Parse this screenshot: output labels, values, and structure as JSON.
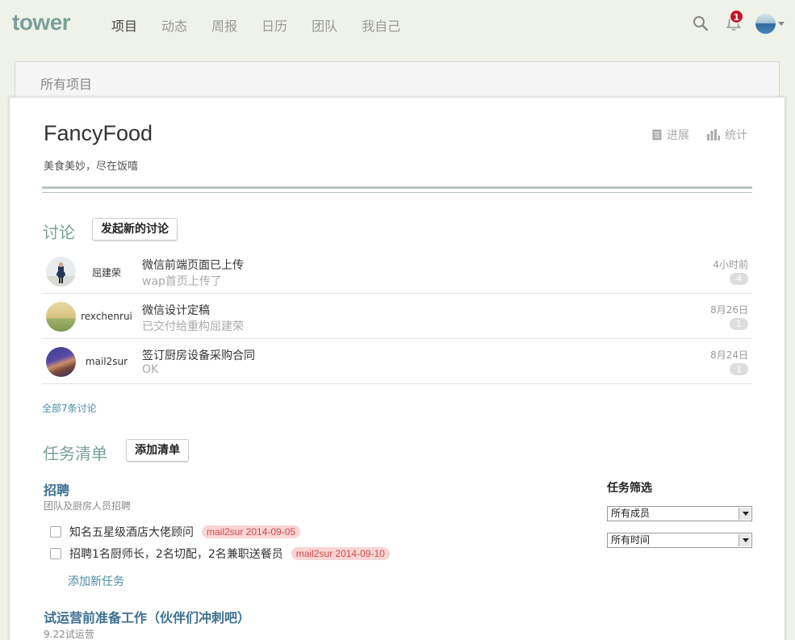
{
  "app": {
    "logo": "tower"
  },
  "nav": {
    "items": [
      "项目",
      "动态",
      "周报",
      "日历",
      "团队",
      "我自己"
    ],
    "active_index": 0
  },
  "header": {
    "notifications_count": "1"
  },
  "breadcrumb": {
    "label": "所有项目"
  },
  "project": {
    "name": "FancyFood",
    "description": "美食美妙，尽在饭嘻",
    "actions": {
      "progress": "进展",
      "stats": "统计"
    }
  },
  "discussions": {
    "title": "讨论",
    "new_button": "发起新的讨论",
    "items": [
      {
        "author": "屈建荣",
        "title": "微信前端页面已上传",
        "excerpt": "wap首页上传了",
        "time": "4小时前",
        "count": "4"
      },
      {
        "author": "rexchenrui",
        "title": "微信设计定稿",
        "excerpt": "已交付给重构屈建荣",
        "time": "8月26日",
        "count": "1"
      },
      {
        "author": "mail2sur",
        "title": "签订厨房设备采购合同",
        "excerpt": "OK",
        "time": "8月24日",
        "count": "1"
      }
    ],
    "all_link": "全部7条讨论"
  },
  "todolists": {
    "title": "任务清单",
    "add_button": "添加清单",
    "lists": [
      {
        "title": "招聘",
        "description": "团队及厨房人员招聘",
        "todos": [
          {
            "text": "知名五星级酒店大佬顾问",
            "tag": "mail2sur 2014-09-05"
          },
          {
            "text": "招聘1名厨师长，2名切配，2名兼职送餐员",
            "tag": "mail2sur 2014-09-10"
          }
        ],
        "add_todo": "添加新任务"
      },
      {
        "title": "试运营前准备工作（伙伴们冲刺吧）",
        "description": "9.22试运营"
      }
    ]
  },
  "filter": {
    "title": "任务筛选",
    "member_select": "所有成员",
    "time_select": "所有时间"
  },
  "colors": {
    "accent": "#7aa09a",
    "link": "#3d7190",
    "badge": "#c8142a",
    "tag_bg": "#f9d5d5",
    "tag_text": "#d24b4b"
  }
}
